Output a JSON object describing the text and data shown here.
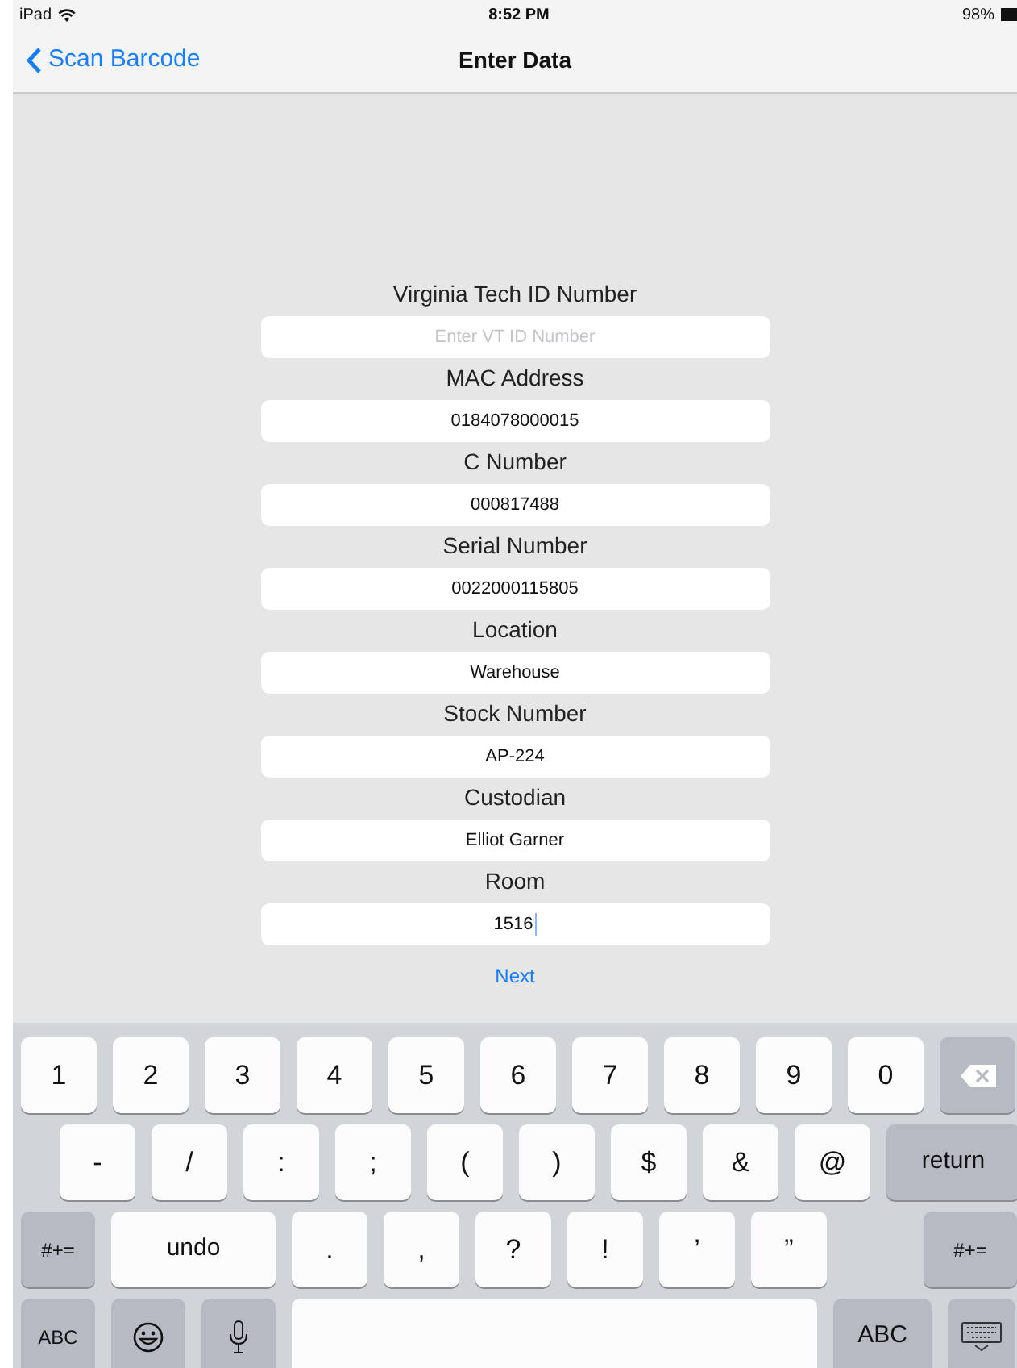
{
  "status_bar": {
    "device": "iPad",
    "time": "8:52 PM",
    "battery": "98%"
  },
  "nav_bar": {
    "back": "Scan Barcode",
    "title": "Enter Data"
  },
  "fields": [
    {
      "label": "Virginia Tech ID Number",
      "placeholder": "Enter VT ID Number",
      "focused": false
    },
    {
      "label": "MAC Address",
      "value": "0184078000015",
      "focused": false
    },
    {
      "label": "C Number",
      "value": "000817488",
      "focused": false
    },
    {
      "label": "Serial Number",
      "value": "0022000115805",
      "focused": false
    },
    {
      "label": "Location",
      "value": "Warehouse",
      "focused": false
    },
    {
      "label": "Stock Number",
      "value": "AP-224",
      "focused": false
    },
    {
      "label": "Custodian",
      "value": "Elliot Garner",
      "focused": false
    },
    {
      "label": "Room",
      "value": "1516",
      "focused": true
    }
  ],
  "next_button": "Next",
  "keyboard": [
    [
      {
        "kind": "char",
        "label": "1"
      },
      {
        "kind": "char",
        "label": "2"
      },
      {
        "kind": "char",
        "label": "3"
      },
      {
        "kind": "char",
        "label": "4"
      },
      {
        "kind": "char",
        "label": "5"
      },
      {
        "kind": "char",
        "label": "6"
      },
      {
        "kind": "char",
        "label": "7"
      },
      {
        "kind": "char",
        "label": "8"
      },
      {
        "kind": "char",
        "label": "9"
      },
      {
        "kind": "char",
        "label": "0"
      },
      {
        "kind": "delete"
      }
    ],
    [
      {
        "kind": "char",
        "label": "-"
      },
      {
        "kind": "char",
        "label": "/"
      },
      {
        "kind": "char",
        "label": ":"
      },
      {
        "kind": "char",
        "label": ";"
      },
      {
        "kind": "char",
        "label": "("
      },
      {
        "kind": "char",
        "label": ")"
      },
      {
        "kind": "char",
        "label": "$"
      },
      {
        "kind": "char",
        "label": "&"
      },
      {
        "kind": "char",
        "label": "@"
      },
      {
        "kind": "return",
        "label": "return"
      }
    ],
    [
      {
        "kind": "mode",
        "label": "#+="
      },
      {
        "kind": "wide",
        "label": "undo"
      },
      {
        "kind": "char",
        "label": "."
      },
      {
        "kind": "char",
        "label": ","
      },
      {
        "kind": "char",
        "label": "?"
      },
      {
        "kind": "char",
        "label": "!"
      },
      {
        "kind": "char",
        "label": "’"
      },
      {
        "kind": "char",
        "label": "”"
      },
      {
        "kind": "gap"
      },
      {
        "kind": "mode-right",
        "label": "#+="
      }
    ],
    [
      {
        "kind": "mode",
        "label": "ABC"
      },
      {
        "kind": "emoji"
      },
      {
        "kind": "mic"
      },
      {
        "kind": "space"
      },
      {
        "kind": "mode-abc",
        "label": "ABC"
      },
      {
        "kind": "hide"
      }
    ]
  ]
}
